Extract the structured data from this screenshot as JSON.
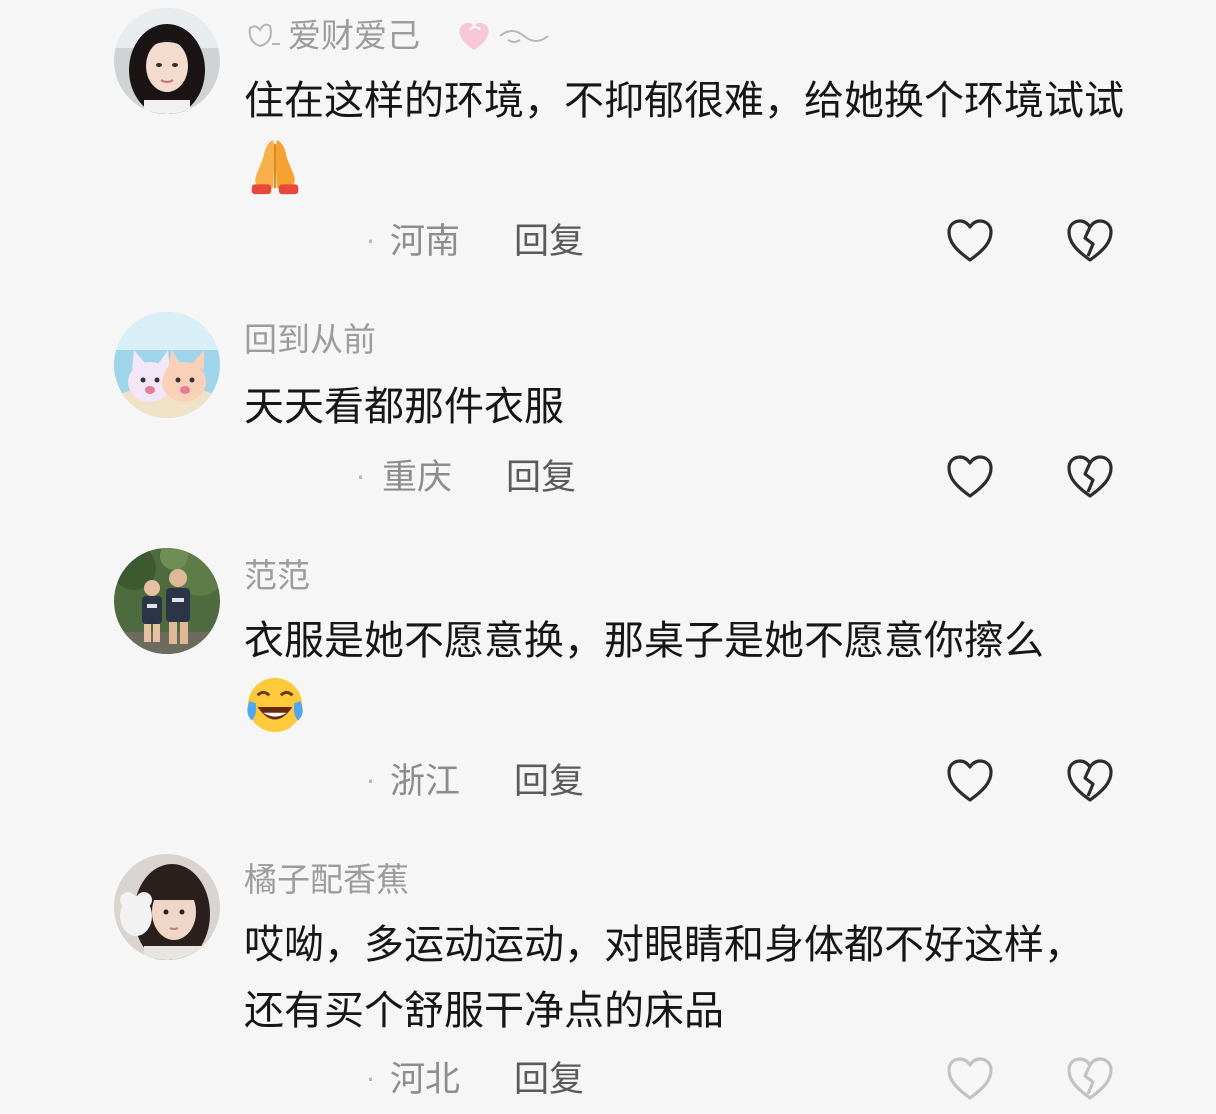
{
  "comments": [
    {
      "username": "爱财爱己",
      "text": "住在这样的环境，不抑郁很难，给她换个环境试试",
      "emoji": "folded-hands",
      "location": "河南",
      "reply_label": "回复"
    },
    {
      "username": "回到从前",
      "text": "天天看都那件衣服",
      "location": "重庆",
      "reply_label": "回复"
    },
    {
      "username": "范范",
      "text": "衣服是她不愿意换，那桌子是她不愿意你擦么",
      "emoji": "crying-laughing-face",
      "location": "浙江",
      "reply_label": "回复"
    },
    {
      "username": "橘子配香蕉",
      "text": "哎呦，多运动运动，对眼睛和身体都不好这样，还有买个舒服干净点的床品",
      "location": "河北",
      "reply_label": "回复"
    }
  ],
  "colors": {
    "background": "#f6f6f6",
    "username": "#9c9c9c",
    "text": "#161616",
    "meta": "#8d8d8d"
  }
}
